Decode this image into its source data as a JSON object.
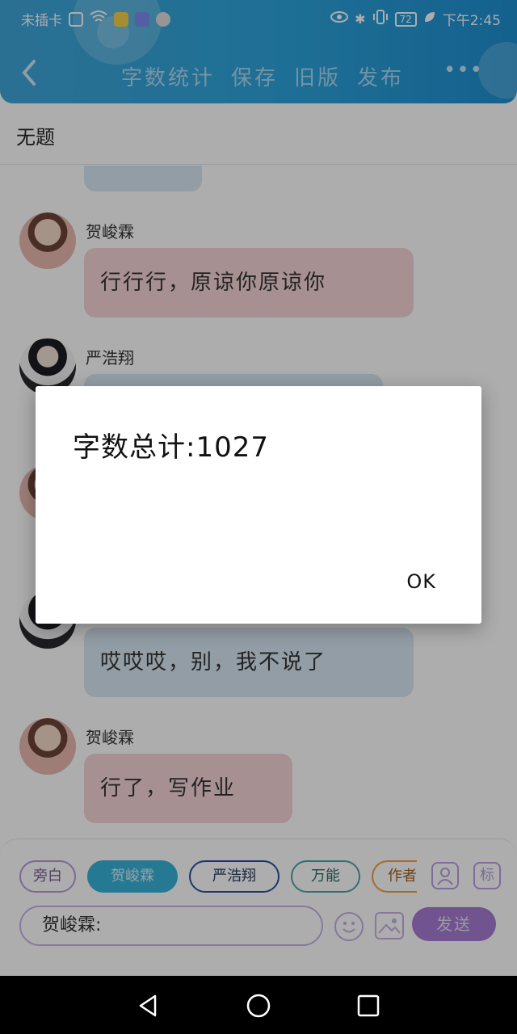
{
  "status_bar": {
    "carrier": "未插卡",
    "battery": "72",
    "time": "下午2:45"
  },
  "toolbar": {
    "menu": [
      "字数统计",
      "保存",
      "旧版",
      "发布"
    ],
    "more": "•••"
  },
  "page": {
    "title": "无题"
  },
  "messages": [
    {
      "speaker": "",
      "text": "",
      "style": "blue"
    },
    {
      "speaker": "贺峻霖",
      "text": "行行行，原谅你原谅你",
      "style": "pink"
    },
    {
      "speaker": "严浩翔",
      "text": "",
      "style": "blue"
    },
    {
      "speaker": "",
      "text": "",
      "style": "pink"
    },
    {
      "speaker": "",
      "text": "哎哎哎，别，我不说了",
      "style": "blue"
    },
    {
      "speaker": "贺峻霖",
      "text": "行了，写作业",
      "style": "pink"
    }
  ],
  "composer": {
    "chips": [
      "旁白",
      "贺峻霖",
      "严浩翔",
      "万能",
      "作者"
    ],
    "tag_label": "标",
    "input_value": "贺峻霖:",
    "send_label": "发送"
  },
  "dialog": {
    "message": "字数总计:1027",
    "ok_label": "OK"
  },
  "colors": {
    "header": "#2da4dd",
    "pink_bubble": "#f7d4d8",
    "blue_bubble": "#d9e8f4",
    "accent": "#a57bd3"
  }
}
